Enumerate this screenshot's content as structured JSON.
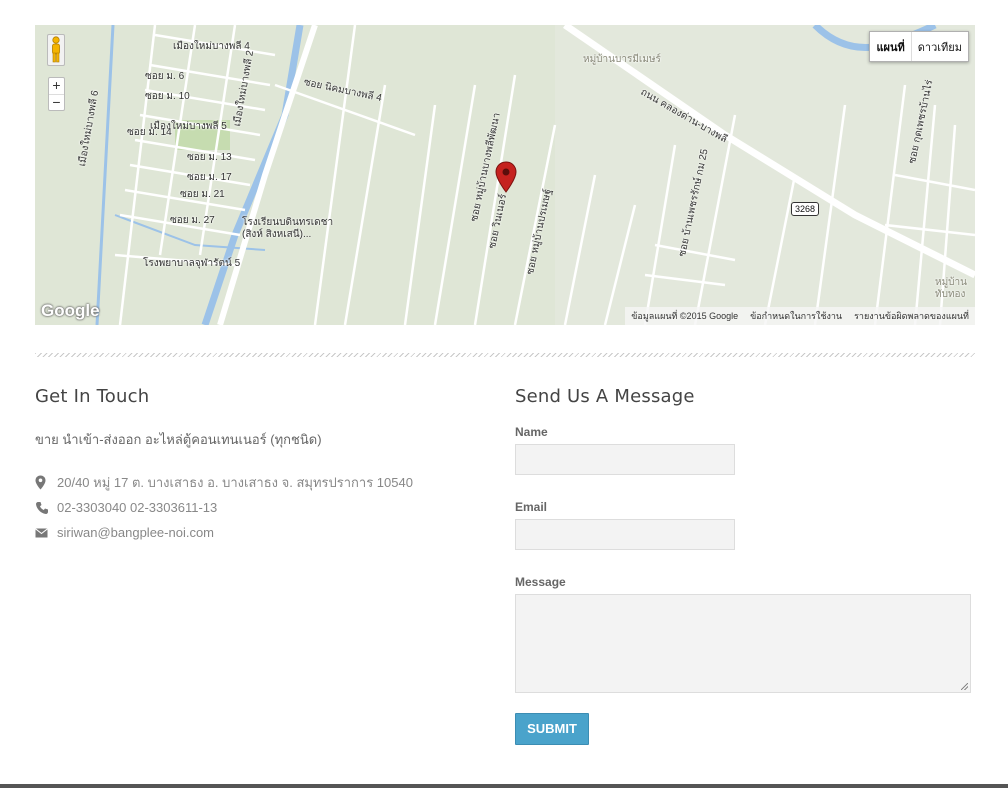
{
  "map": {
    "map_type_buttons": [
      "แผนที่",
      "ดาวเทียม"
    ],
    "zoom_in": "+",
    "zoom_out": "−",
    "logo": "Google",
    "attribution": [
      "ข้อมูลแผนที่ ©2015 Google",
      "ข้อกำหนดในการใช้งาน",
      "รายงานข้อผิดพลาดของแผนที่"
    ],
    "labels": [
      "เมืองใหม่บางพลี 4",
      "ซอย ม. 6",
      "ซอย ม. 10",
      "เมืองใหม่บางพลี 5",
      "ซอย ม. 14",
      "ซอย ม. 13",
      "ซอย ม. 17",
      "ซอย ม. 21",
      "ซอย ม. 27",
      "เมืองใหม่บางพลี 6",
      "เมืองใหม่บางพลี 2",
      "ซอย นิคมบางพลี 4",
      "โรงเรียนบดินทรเดชา (สิงห์ สิงหเสนี)...",
      "โรงพยาบาลจุฬารัตน์ 5",
      "หมู่บ้านบารมีเมษร์",
      "ถนน คลองด่าน-บางพลี",
      "ซอย หมู่บ้านบางพลีพัฒนา",
      "ซอย วินเนอร์",
      "ซอย หมู่บ้านปรเมษฐ์",
      "ซอย บ้านเพชรรักษ์ กม 25",
      "ซอย กุดเพชรบ้านไร่",
      "3268",
      "หมู่บ้าน ทับทอง"
    ]
  },
  "contact": {
    "heading": "Get In Touch",
    "description": "ขาย นำเข้า-ส่งออก อะไหล่ตู้คอนเทนเนอร์ (ทุกชนิด)",
    "address": "20/40 หมู่ 17 ต. บางเสาธง อ. บางเสาธง จ. สมุทรปราการ 10540",
    "phone": "02-3303040 02-3303611-13",
    "email": "siriwan@bangplee-noi.com"
  },
  "form": {
    "heading": "Send Us A Message",
    "name_label": "Name",
    "email_label": "Email",
    "message_label": "Message",
    "submit_label": "SUBMIT"
  },
  "colors": {
    "accent": "#4aa3cb",
    "marker": "#c5221f"
  },
  "icons": [
    "person-icon",
    "map-marker-icon",
    "location-pin-icon",
    "phone-icon",
    "envelope-icon"
  ]
}
